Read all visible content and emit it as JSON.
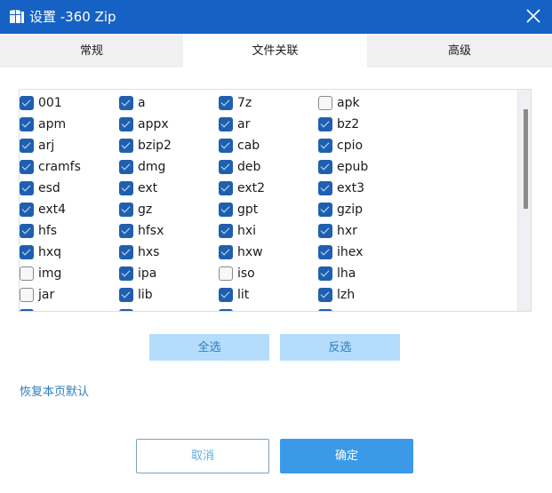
{
  "window": {
    "title": "设置 -360 Zip",
    "app_icon": "360zip-book-icon",
    "close_icon": "close-icon"
  },
  "tabs": [
    {
      "label": "常规",
      "active": false
    },
    {
      "label": "文件关联",
      "active": true
    },
    {
      "label": "高级",
      "active": false
    }
  ],
  "file_types": [
    {
      "ext": "001",
      "checked": true
    },
    {
      "ext": "a",
      "checked": true
    },
    {
      "ext": "7z",
      "checked": true
    },
    {
      "ext": "apk",
      "checked": false
    },
    {
      "ext": "apm",
      "checked": true
    },
    {
      "ext": "appx",
      "checked": true
    },
    {
      "ext": "ar",
      "checked": true
    },
    {
      "ext": "bz2",
      "checked": true
    },
    {
      "ext": "arj",
      "checked": true
    },
    {
      "ext": "bzip2",
      "checked": true
    },
    {
      "ext": "cab",
      "checked": true
    },
    {
      "ext": "cpio",
      "checked": true
    },
    {
      "ext": "cramfs",
      "checked": true
    },
    {
      "ext": "dmg",
      "checked": true
    },
    {
      "ext": "deb",
      "checked": true
    },
    {
      "ext": "epub",
      "checked": true
    },
    {
      "ext": "esd",
      "checked": true
    },
    {
      "ext": "ext",
      "checked": true
    },
    {
      "ext": "ext2",
      "checked": true
    },
    {
      "ext": "ext3",
      "checked": true
    },
    {
      "ext": "ext4",
      "checked": true
    },
    {
      "ext": "gz",
      "checked": true
    },
    {
      "ext": "gpt",
      "checked": true
    },
    {
      "ext": "gzip",
      "checked": true
    },
    {
      "ext": "hfs",
      "checked": true
    },
    {
      "ext": "hfsx",
      "checked": true
    },
    {
      "ext": "hxi",
      "checked": true
    },
    {
      "ext": "hxr",
      "checked": true
    },
    {
      "ext": "hxq",
      "checked": true
    },
    {
      "ext": "hxs",
      "checked": true
    },
    {
      "ext": "hxw",
      "checked": true
    },
    {
      "ext": "ihex",
      "checked": true
    },
    {
      "ext": "img",
      "checked": false
    },
    {
      "ext": "ipa",
      "checked": true
    },
    {
      "ext": "iso",
      "checked": false
    },
    {
      "ext": "lha",
      "checked": true
    },
    {
      "ext": "jar",
      "checked": false
    },
    {
      "ext": "lib",
      "checked": true
    },
    {
      "ext": "lit",
      "checked": true
    },
    {
      "ext": "lzh",
      "checked": true
    },
    {
      "ext": "",
      "checked": true
    },
    {
      "ext": "",
      "checked": true
    },
    {
      "ext": "",
      "checked": true
    },
    {
      "ext": "",
      "checked": true
    }
  ],
  "buttons": {
    "select_all": "全选",
    "invert_selection": "反选",
    "restore_defaults": "恢复本页默认",
    "cancel": "取消",
    "ok": "确定"
  },
  "colors": {
    "titlebar": "#1662c4",
    "checkbox_checked": "#1f5fae",
    "primary_button": "#3b9ae8",
    "secondary_button": "#b5dcfa",
    "link": "#2a7fc0"
  }
}
